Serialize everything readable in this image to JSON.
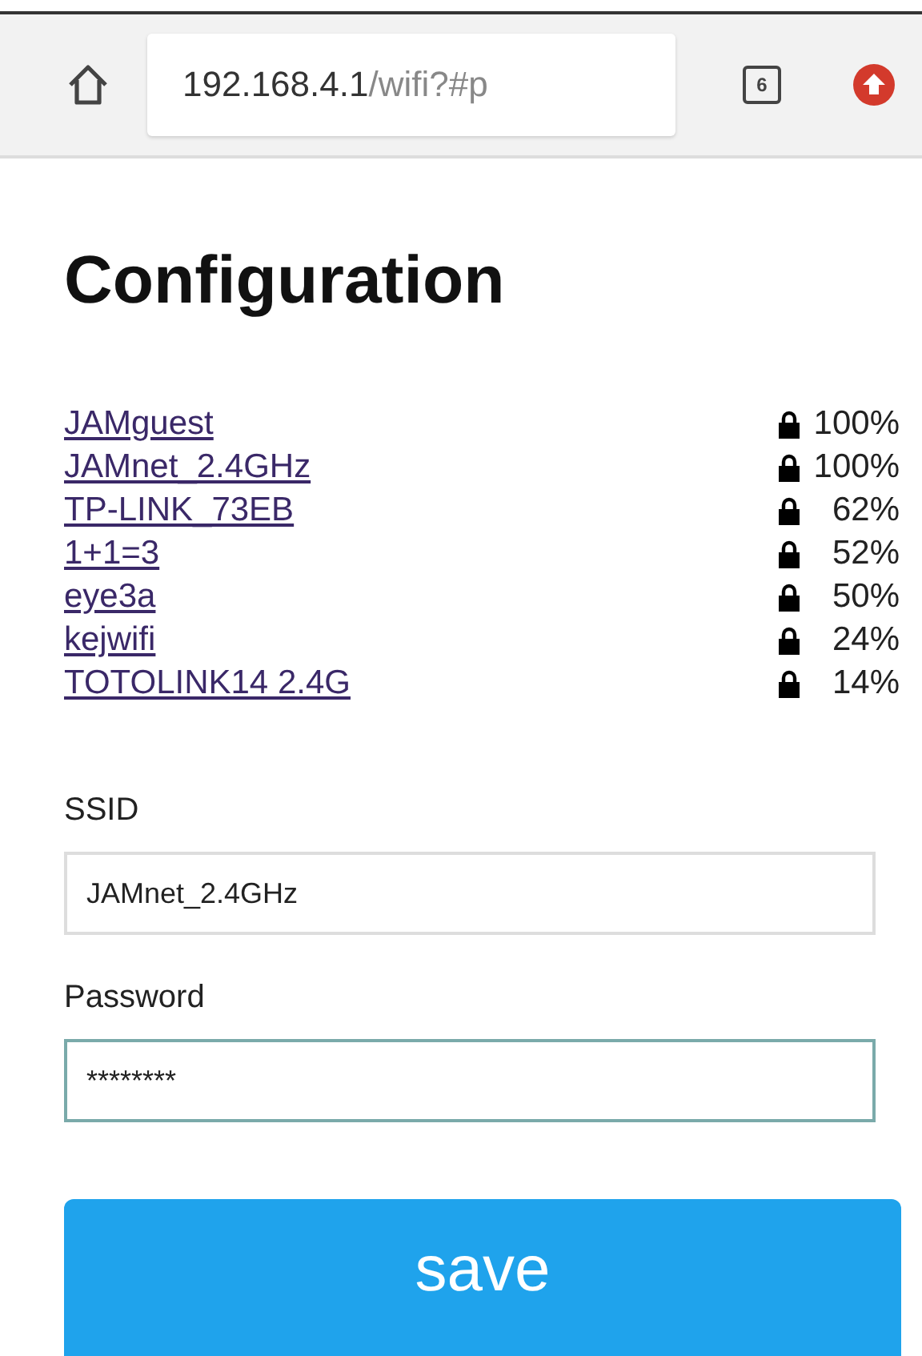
{
  "browser_bar": {
    "url_host": "192.168.4.1",
    "url_path": "/wifi?#p",
    "tab_count": "6"
  },
  "title": "Configuration",
  "networks": [
    {
      "name": "JAMguest",
      "locked": true,
      "signal": "100%"
    },
    {
      "name": "JAMnet_2.4GHz",
      "locked": true,
      "signal": "100%"
    },
    {
      "name": "TP-LINK_73EB",
      "locked": true,
      "signal": "62%"
    },
    {
      "name": "1+1=3",
      "locked": true,
      "signal": "52%"
    },
    {
      "name": "eye3a",
      "locked": true,
      "signal": "50%"
    },
    {
      "name": "kejwifi",
      "locked": true,
      "signal": "24%"
    },
    {
      "name": "TOTOLINK14 2.4G",
      "locked": true,
      "signal": "14%"
    }
  ],
  "fields": [
    {
      "label": "SSID",
      "value": "JAMnet_2.4GHz",
      "focused": false
    },
    {
      "label": "Password",
      "value": "********",
      "focused": true
    }
  ],
  "save_button": "save"
}
